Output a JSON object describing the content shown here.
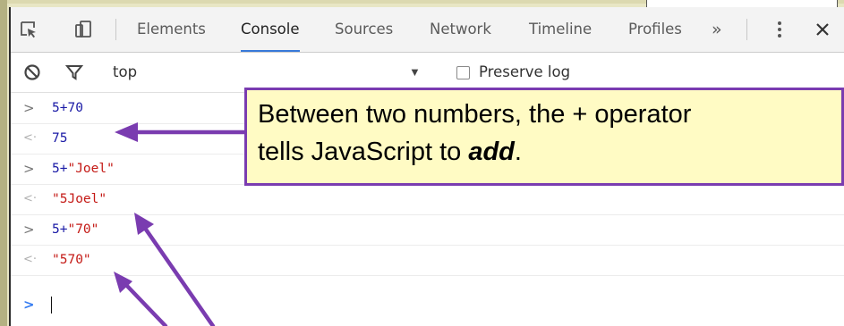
{
  "devtools": {
    "tabs": [
      {
        "label": "Elements"
      },
      {
        "label": "Console"
      },
      {
        "label": "Sources"
      },
      {
        "label": "Network"
      },
      {
        "label": "Timeline"
      },
      {
        "label": "Profiles"
      }
    ],
    "active_tab": "Console",
    "overflow_label": "»",
    "accent_color": "#3879d9"
  },
  "filterbar": {
    "context": "top",
    "preserve_log_label": "Preserve log",
    "preserve_log_checked": false
  },
  "console": {
    "lines": [
      {
        "kind": "input",
        "prompt": ">",
        "parts": [
          "5+70"
        ]
      },
      {
        "kind": "result",
        "prompt": "<·",
        "parts": [
          "75"
        ]
      },
      {
        "kind": "input",
        "prompt": ">",
        "parts": [
          "5+",
          "\"Joel\""
        ]
      },
      {
        "kind": "result",
        "prompt": "<·",
        "parts": [
          "\"5Joel\""
        ]
      },
      {
        "kind": "input",
        "prompt": ">",
        "parts": [
          "5+",
          "\"70\""
        ]
      },
      {
        "kind": "result",
        "prompt": "<·",
        "parts": [
          "\"570\""
        ]
      },
      {
        "kind": "caret",
        "prompt": ">"
      }
    ],
    "colors": {
      "number": "#1a1aa6",
      "string": "#c41a16"
    }
  },
  "callout": {
    "line1": "Between two numbers, the + operator",
    "line2_prefix": "tells JavaScript to ",
    "line2_emphasis": "add",
    "line2_suffix": ".",
    "border_color": "#7a3cb0",
    "fill_color": "#fffbc4"
  }
}
